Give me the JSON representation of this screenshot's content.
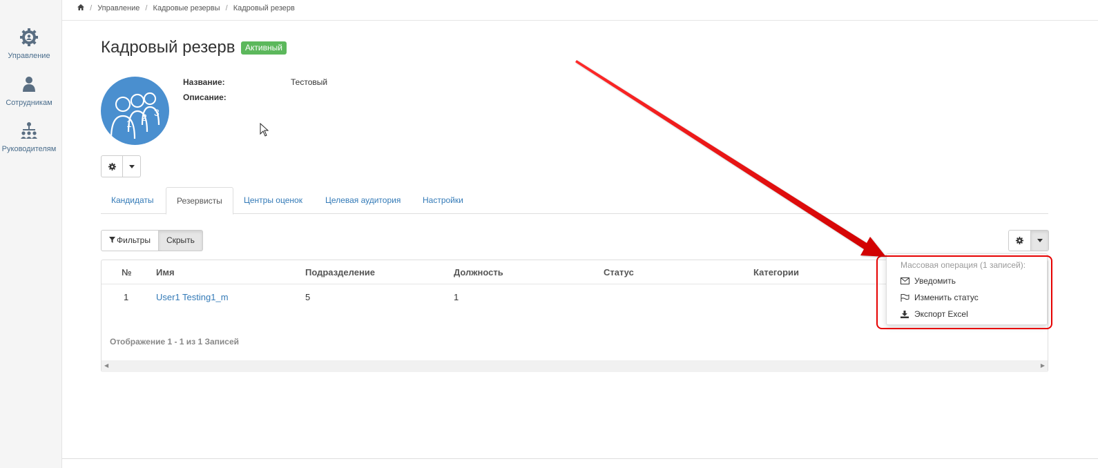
{
  "sidebar": {
    "items": [
      {
        "label": "Управление",
        "icon": "gear-icon"
      },
      {
        "label": "Сотрудникам",
        "icon": "user-icon"
      },
      {
        "label": "Руководителям",
        "icon": "org-chart-icon"
      }
    ]
  },
  "breadcrumb": {
    "home_icon": "home-icon",
    "items": [
      "Управление",
      "Кадровые резервы",
      "Кадровый резерв"
    ]
  },
  "page": {
    "title": "Кадровый резерв",
    "status_badge": "Активный",
    "status_color": "#5cb85c"
  },
  "details": {
    "name_label": "Название:",
    "name_value": "Тестовый",
    "description_label": "Описание:",
    "description_value": ""
  },
  "avatar": {
    "icon": "reserve-group-icon",
    "numbers": [
      "1",
      "2",
      "3"
    ],
    "color": "#4a8fcf"
  },
  "tabs": [
    {
      "label": "Кандидаты",
      "active": false
    },
    {
      "label": "Резервисты",
      "active": true
    },
    {
      "label": "Центры оценок",
      "active": false
    },
    {
      "label": "Целевая аудитория",
      "active": false
    },
    {
      "label": "Настройки",
      "active": false
    }
  ],
  "filters": {
    "filter_label": "Фильтры",
    "hide_label": "Скрыть"
  },
  "table": {
    "columns": [
      "№",
      "Имя",
      "Подразделение",
      "Должность",
      "Статус",
      "Категории"
    ],
    "rows": [
      {
        "num": "1",
        "name": "User1 Testing1_m",
        "department": "5",
        "position": "1",
        "status": "",
        "categories": ""
      }
    ],
    "summary": "Отображение 1 - 1 из 1 Записей"
  },
  "mass_menu": {
    "header": "Массовая операция (1 записей):",
    "items": [
      {
        "label": "Уведомить",
        "icon": "envelope-icon"
      },
      {
        "label": "Изменить статус",
        "icon": "flag-icon"
      },
      {
        "label": "Экспорт Excel",
        "icon": "download-icon"
      }
    ]
  },
  "annotation": {
    "arrow_color": "#e60000"
  }
}
